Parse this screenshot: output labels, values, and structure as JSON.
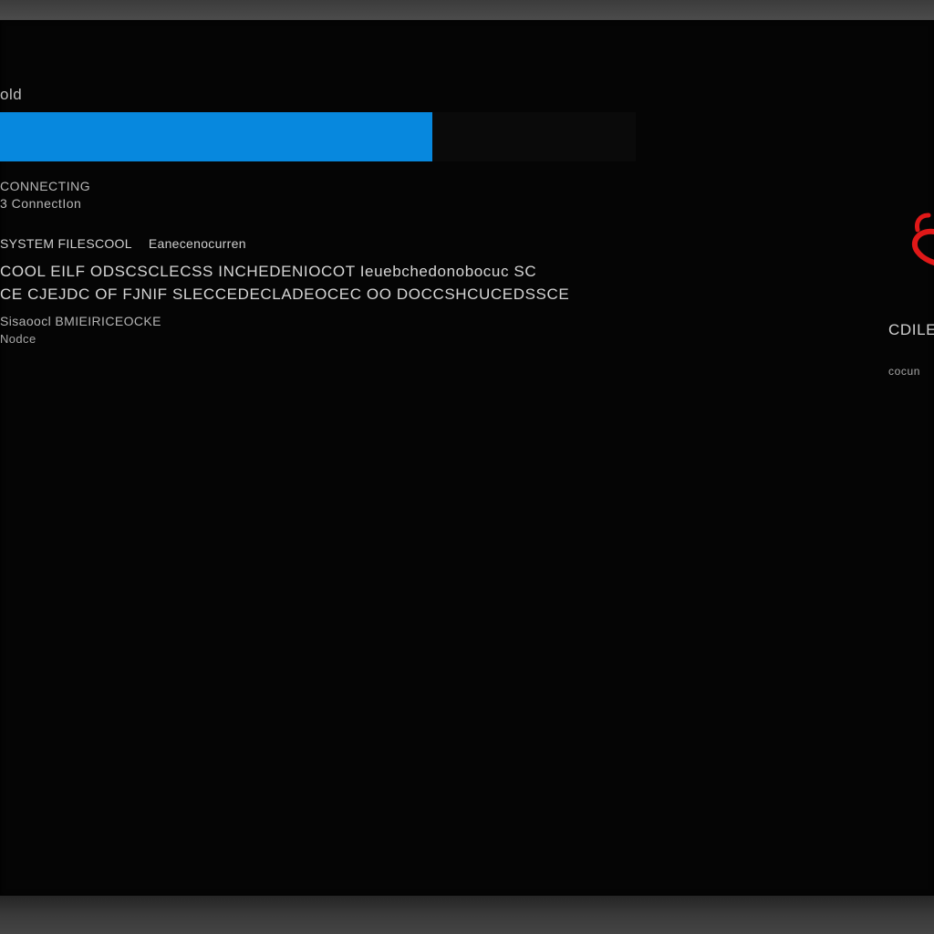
{
  "header": {
    "label": "old"
  },
  "progress": {
    "fraction": 0.68,
    "color": "#0788de"
  },
  "lines": {
    "line1": "CONNECTING",
    "line2": "3 ConnectIon",
    "line3a": "SYSTEM FILESCOOL",
    "line3b": "Eanecenocurren",
    "line4": "COOL EILF ODSCSCLECSS INCHEDENIOCOT Ieuebchedonobocuc SC",
    "line5": "CE CJEJDC OF FJNIF SLECCEDECLADEOCEC OO DOCCSHCUCEDSSCE",
    "line6": "Sisaoocl BMIEIRICEOCKE",
    "line7": "Nodce"
  },
  "side_panel": {
    "icon": "lock-icon",
    "accent_color": "#e01818",
    "title": "CDILE",
    "subtitle": "cocun"
  }
}
